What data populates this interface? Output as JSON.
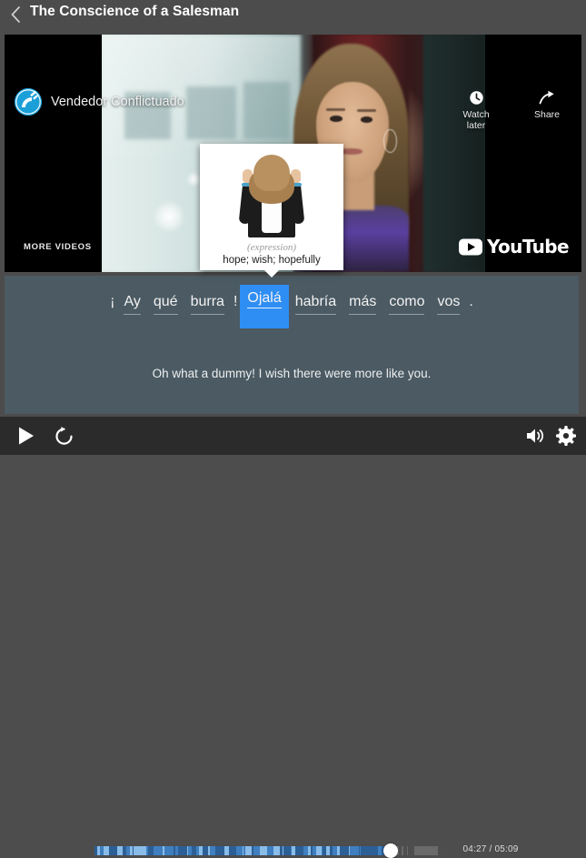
{
  "header": {
    "back_icon": "chevron-left-icon",
    "title": "The Conscience of a Salesman"
  },
  "video": {
    "channel_name": "Vendedor Conflictuado",
    "avatar_icon": "satellite-dish-icon",
    "actions": [
      {
        "label": "Watch later",
        "icon": "clock-icon"
      },
      {
        "label": "Share",
        "icon": "share-arrow-icon"
      }
    ],
    "more_videos_label": "MORE VIDEOS",
    "brand_label": "YouTube",
    "brand_icon": "youtube-play-icon"
  },
  "popup": {
    "image_alt": "woman-crossed-fingers-image",
    "part_of_speech": "(expression)",
    "definition": "hope; wish; hopefully"
  },
  "subtitle": {
    "words": [
      {
        "text": "¡",
        "underline": false,
        "active": false,
        "punct": true
      },
      {
        "text": "Ay",
        "underline": true,
        "active": false,
        "punct": false
      },
      {
        "text": "qué",
        "underline": true,
        "active": false,
        "punct": false
      },
      {
        "text": "burra",
        "underline": true,
        "active": false,
        "punct": false
      },
      {
        "text": "!",
        "underline": false,
        "active": false,
        "punct": true
      },
      {
        "text": "Ojalá",
        "underline": true,
        "active": true,
        "punct": false
      },
      {
        "text": "habría",
        "underline": true,
        "active": false,
        "punct": false
      },
      {
        "text": "más",
        "underline": true,
        "active": false,
        "punct": false
      },
      {
        "text": "como",
        "underline": true,
        "active": false,
        "punct": false
      },
      {
        "text": "vos",
        "underline": true,
        "active": false,
        "punct": false
      },
      {
        "text": ".",
        "underline": false,
        "active": false,
        "punct": true
      }
    ],
    "translation": "Oh what a dummy! I wish there were more like you."
  },
  "controls": {
    "play_icon": "play-icon",
    "replay_icon": "replay-icon",
    "volume_icon": "volume-icon",
    "settings_icon": "gear-icon",
    "current_time": "04:27",
    "total_time": "05:09",
    "timecode": "04:27 / 05:09",
    "progress_percent": 84
  },
  "colors": {
    "accent": "#2f8ef4",
    "panel": "#4b5a63",
    "chrome": "#4c4c4c",
    "control_bar": "#2b2b2b",
    "avatar": "#1b9fd8"
  }
}
